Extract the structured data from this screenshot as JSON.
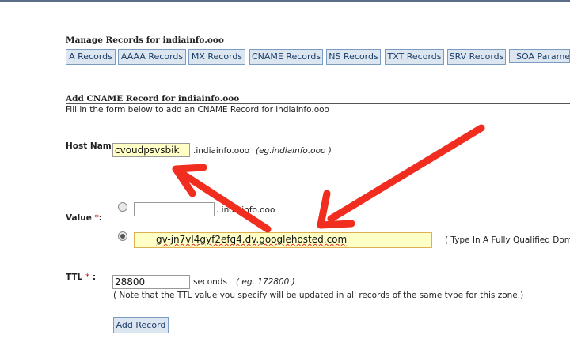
{
  "manage": {
    "title": "Manage Records for indiainfo.ooo",
    "tabs": [
      "A Records",
      "AAAA Records",
      "MX Records",
      "CNAME Records",
      "NS Records",
      "TXT Records",
      "SRV Records",
      "SOA Paramete"
    ]
  },
  "add": {
    "title": "Add CNAME Record for indiainfo.ooo",
    "description": "Fill in the form below to add an CNAME Record for indiainfo.ooo"
  },
  "host": {
    "label": "Host Name",
    "colon": ":",
    "value": "cvoudpsvsbik",
    "suffix": ".indiainfo.ooo",
    "example": "(eg.indiainfo.ooo )"
  },
  "value_field": {
    "label": "Value",
    "required": "*",
    "colon": ":",
    "option1_suffix": ". indiainfo.ooo",
    "option1_value": "",
    "option2_value": "gv-jn7vl4gyf2efq4.dv.googlehosted.com",
    "hint": "( Type In A Fully Qualified Domain N"
  },
  "ttl": {
    "label": "TTL",
    "required": "*",
    "colon": ":",
    "value": "28800",
    "unit": "seconds",
    "example": "( eg. 172800 )",
    "note": "( Note that the TTL value you specify will be updated in all records of the same type for this zone.)"
  },
  "submit_label": "Add Record",
  "colors": {
    "arrow": "#f02d1e",
    "highlight": "#ffffc6",
    "tab_bg": "#dce6f1",
    "required": "#d00000"
  }
}
